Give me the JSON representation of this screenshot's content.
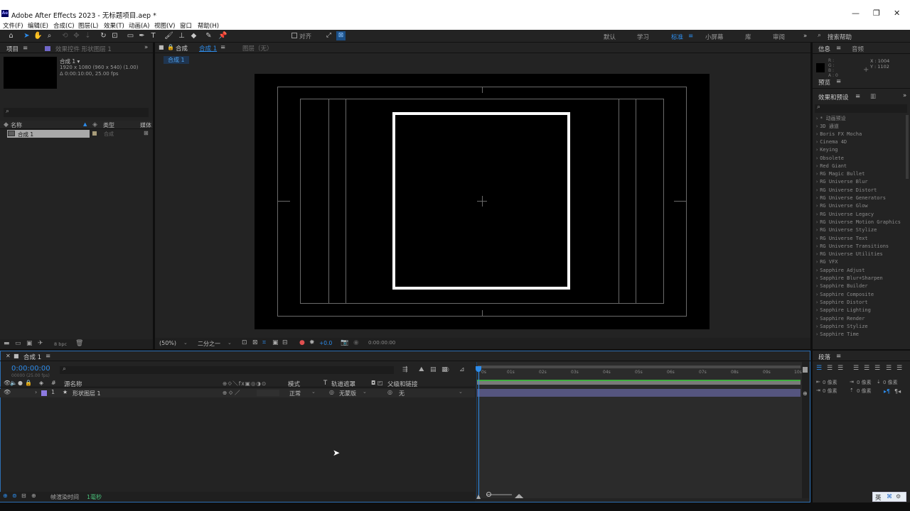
{
  "window": {
    "app_badge": "Ae",
    "title": "Adobe After Effects 2023 - 无标题项目.aep *",
    "controls": [
      "—",
      "❐",
      "✕"
    ]
  },
  "menu": [
    "文件(F)",
    "编辑(E)",
    "合成(C)",
    "图层(L)",
    "效果(T)",
    "动画(A)",
    "视图(V)",
    "窗口",
    "帮助(H)"
  ],
  "toolbar": {
    "snap_label": "对齐",
    "workspaces": [
      "默认",
      "学习",
      "标准",
      "小屏幕",
      "库",
      "审阅"
    ],
    "active_workspace": "标准",
    "search_placeholder": "搜索帮助"
  },
  "project": {
    "tab_project": "项目",
    "tab_effects": "效果控件 形状图层 1",
    "comp_name": "合成 1 ▾",
    "comp_info1": "1920 x 1080 (960 x 540) (1.00)",
    "comp_info2": "Δ 0:00:10:00, 25.00 fps",
    "col_name": "名称",
    "col_type": "类型",
    "col_media": "媒体",
    "item_name": "合成 1",
    "item_type": "合成",
    "bpc": "8 bpc"
  },
  "viewer": {
    "tab_comp": "合成",
    "tab_comp_name": "合成 1",
    "tab_layer": "图层（无）",
    "breadcrumb": "合成 1",
    "zoom": "(50%)",
    "resolution": "二分之一",
    "exposure": "+0.0",
    "timecode": "0:00:00:00"
  },
  "right": {
    "tab_info": "信息",
    "tab_audio": "音频",
    "info_labels": [
      "R :",
      "G :",
      "B :",
      "A : 0"
    ],
    "info_x": "X : 1004",
    "info_y": "Y : 1102",
    "tab_preview": "预览",
    "tab_effects": "效果和预设",
    "effects": [
      "* 动画预设",
      "3D 通道",
      "Boris FX Mocha",
      "Cinema 4D",
      "Keying",
      "Obsolete",
      "Red Giant",
      "RG Magic Bullet",
      "RG Universe Blur",
      "RG Universe Distort",
      "RG Universe Generators",
      "RG Universe Glow",
      "RG Universe Legacy",
      "RG Universe Motion Graphics",
      "RG Universe Stylize",
      "RG Universe Text",
      "RG Universe Transitions",
      "RG Universe Utilities",
      "RG VFX",
      "Sapphire Adjust",
      "Sapphire Blur+Sharpen",
      "Sapphire Builder",
      "Sapphire Composite",
      "Sapphire Distort",
      "Sapphire Lighting",
      "Sapphire Render",
      "Sapphire Stylize",
      "Sapphire Time"
    ]
  },
  "timeline": {
    "tab": "合成 1",
    "timecode": "0:00:00:00",
    "frame_info": "00000 (25.00 fps)",
    "col_source": "源名称",
    "col_mode": "模式",
    "col_t": "T",
    "col_matte": "轨道遮罩",
    "col_parent": "父级和链接",
    "layer_num": "1",
    "layer_name": "形状图层 1",
    "layer_mode": "正常",
    "layer_matte": "无蒙版",
    "layer_parent": "无",
    "ruler": [
      "0s",
      "01s",
      "02s",
      "03s",
      "04s",
      "05s",
      "06s",
      "07s",
      "08s",
      "09s",
      "10s"
    ],
    "render_label": "帧渲染时间",
    "render_value": "1毫秒"
  },
  "paragraph": {
    "tab": "段落",
    "indent_values": [
      "0 像素",
      "0 像素",
      "0 像素",
      "0 像素",
      "0 像素"
    ]
  },
  "status": {
    "ime": "英"
  },
  "colors": {
    "accent": "#2d8ceb",
    "layer_label": "#8d7ae0",
    "layer_bar": "#55557f",
    "green_line": "#3fae3f"
  }
}
